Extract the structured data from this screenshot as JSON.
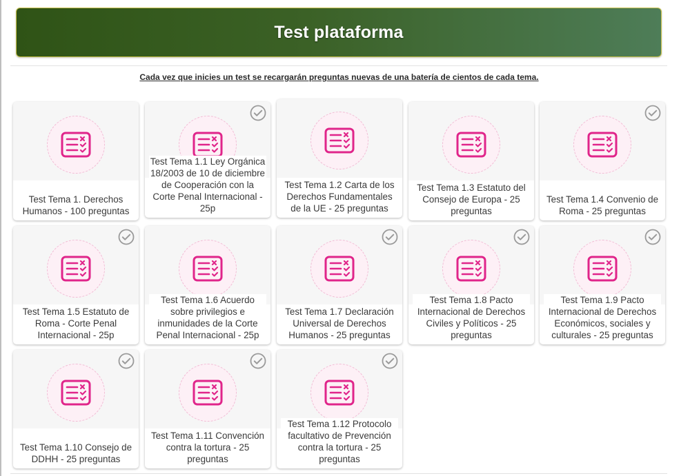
{
  "header": {
    "title": "Test plataforma"
  },
  "notice": "Cada vez que inicies un test se recargarán preguntas nuevas de una batería de cientos de cada tema.",
  "colors": {
    "accent": "#e0248a",
    "banner_start": "#2f5316",
    "banner_end": "#4e7d58",
    "check": "#9a9a9a"
  },
  "icons": {
    "test": "checklist-icon",
    "done": "checkmark-circle-icon"
  },
  "tests": [
    {
      "label": "Test Tema 1. Derechos Humanos - 100 preguntas",
      "completed": false
    },
    {
      "label": "Test Tema 1.1 Ley Orgánica 18/2003 de 10 de diciembre de Cooperación con la Corte Penal Internacional - 25p",
      "completed": true
    },
    {
      "label": "Test Tema 1.2 Carta de los Derechos Fundamentales de la UE - 25 preguntas",
      "completed": false
    },
    {
      "label": "Test Tema 1.3 Estatuto del Consejo de Europa - 25 preguntas",
      "completed": false
    },
    {
      "label": "Test Tema 1.4 Convenio de Roma - 25 preguntas",
      "completed": true
    },
    {
      "label": "Test Tema 1.5 Estatuto de Roma - Corte Penal Internacional - 25p",
      "completed": true
    },
    {
      "label": "Test Tema 1.6 Acuerdo sobre privilegios e inmunidades de la Corte Penal Internacional - 25p",
      "completed": false
    },
    {
      "label": "Test Tema 1.7 Declaración Universal de Derechos Humanos - 25 preguntas",
      "completed": true
    },
    {
      "label": "Test Tema 1.8 Pacto Internacional de Derechos Civiles y Políticos - 25 preguntas",
      "completed": true
    },
    {
      "label": "Test Tema 1.9 Pacto Internacional de Derechos Económicos, sociales y culturales - 25 preguntas",
      "completed": true
    },
    {
      "label": "Test Tema 1.10 Consejo de DDHH - 25 preguntas",
      "completed": true
    },
    {
      "label": "Test Tema 1.11 Convención contra la tortura - 25 preguntas",
      "completed": true
    },
    {
      "label": "Test Tema 1.12 Protocolo facultativo de Prevención contra la tortura - 25 preguntas",
      "completed": true
    }
  ]
}
